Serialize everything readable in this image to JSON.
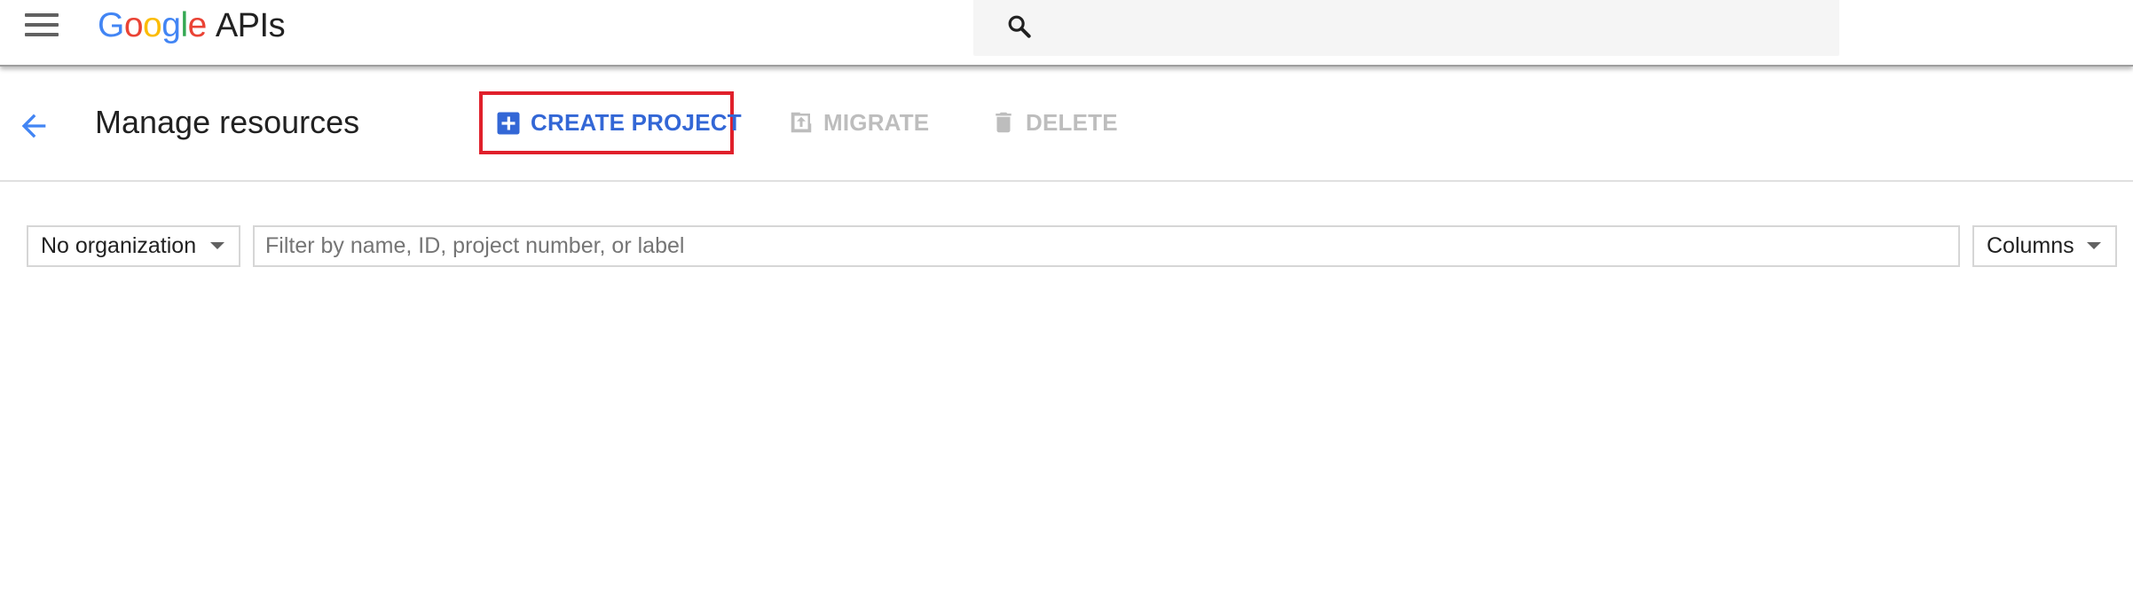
{
  "header": {
    "logo": {
      "letters": [
        "G",
        "o",
        "o",
        "g",
        "l",
        "e"
      ],
      "product": "APIs"
    },
    "search": {
      "icon": "search-icon",
      "value": ""
    },
    "menu_icon": "hamburger-menu-icon"
  },
  "toolbar": {
    "back_icon": "arrow-left-icon",
    "title": "Manage resources",
    "create_label": "CREATE PROJECT",
    "create_icon": "add-box-icon",
    "migrate_label": "MIGRATE",
    "migrate_icon": "migrate-upload-icon",
    "delete_label": "DELETE",
    "delete_icon": "trash-icon"
  },
  "filters": {
    "organization": "No organization",
    "filter_placeholder": "Filter by name, ID, project number, or label",
    "filter_value": "",
    "columns": "Columns"
  },
  "colors": {
    "accent_blue": "#3367d6",
    "highlight_red": "#e0202b",
    "disabled_gray": "#bdbdbd",
    "google_blue": "#4285f4",
    "google_red": "#ea4335",
    "google_yellow": "#fbbc05",
    "google_green": "#34a853"
  }
}
